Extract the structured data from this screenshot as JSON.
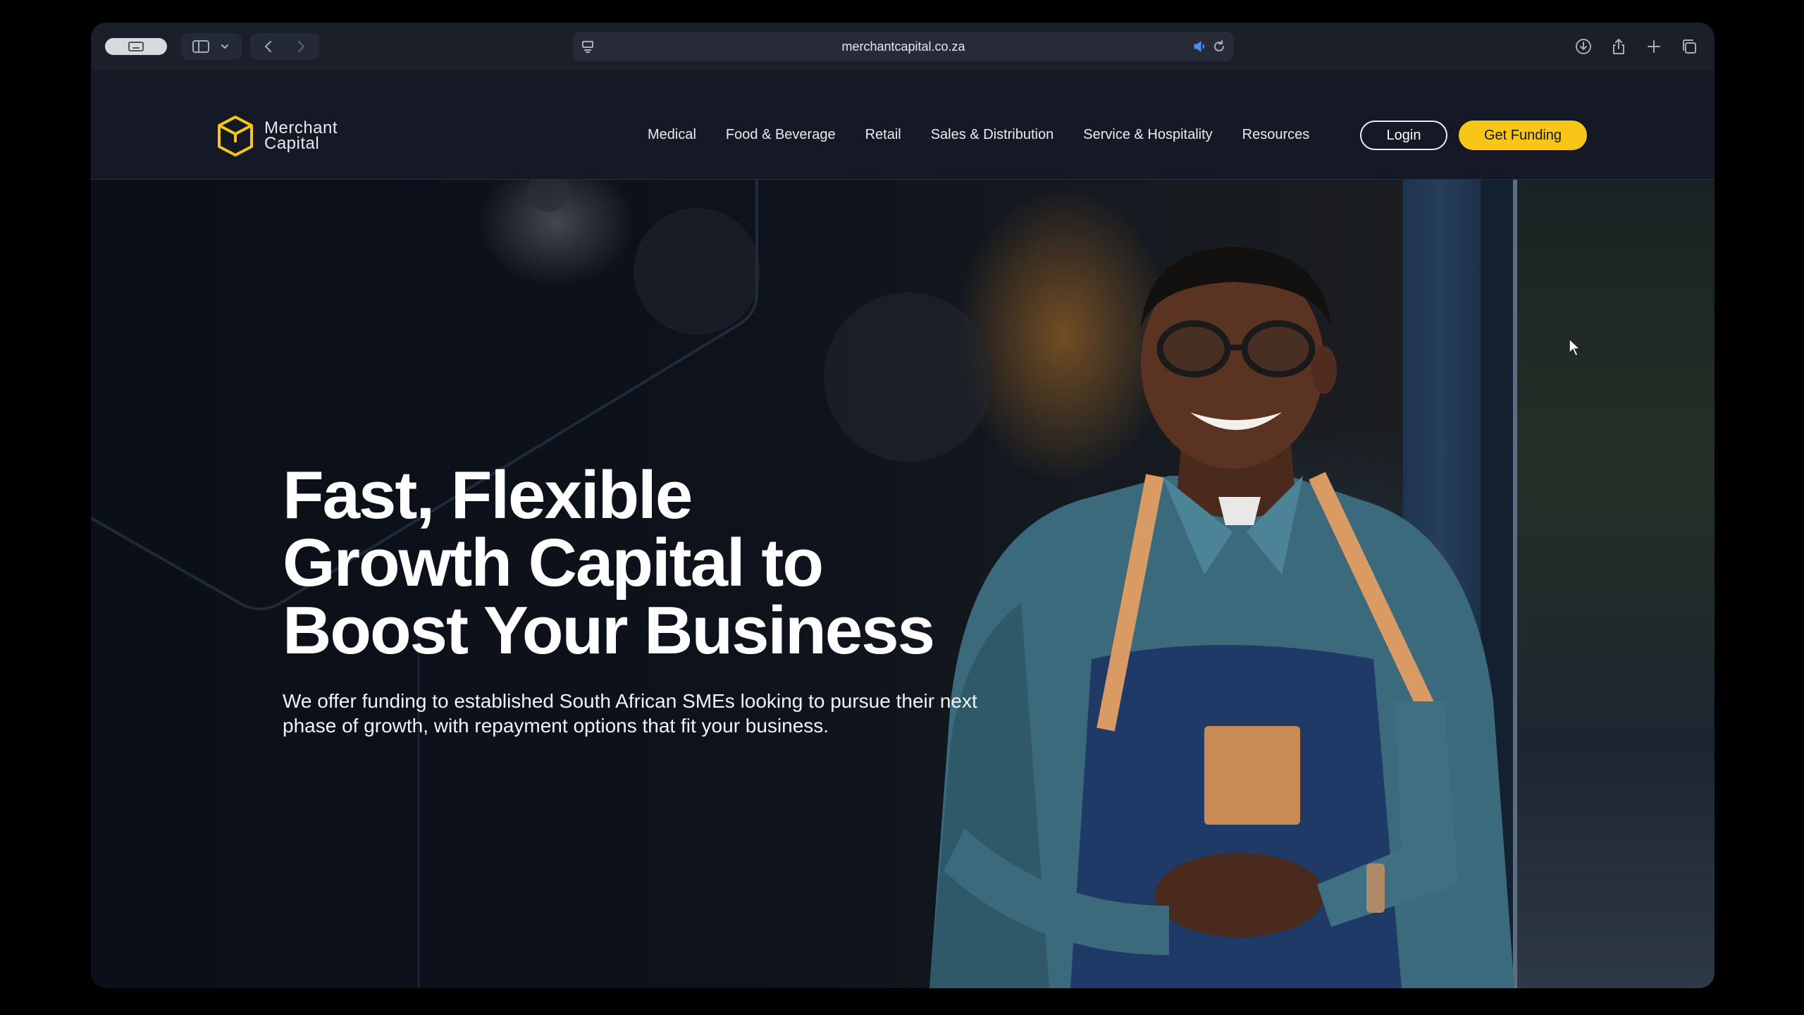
{
  "browser": {
    "url": "merchantcapital.co.za",
    "icons": {
      "tab_overview": "tab-overview-icon",
      "sidebar": "sidebar-icon",
      "chevron": "chevron-down-icon",
      "back": "back-icon",
      "forward": "forward-icon",
      "page_menu": "page-menu-icon",
      "audio": "speaker-icon",
      "reload": "reload-icon",
      "downloads": "download-icon",
      "share": "share-icon",
      "new_tab": "plus-icon",
      "tabs": "tabs-icon"
    }
  },
  "site": {
    "logo": {
      "line1": "Merchant",
      "line2": "Capital",
      "icon": "cube-logo-icon"
    },
    "nav": [
      {
        "label": "Medical"
      },
      {
        "label": "Food & Beverage"
      },
      {
        "label": "Retail"
      },
      {
        "label": "Sales & Distribution"
      },
      {
        "label": "Service & Hospitality"
      },
      {
        "label": "Resources"
      }
    ],
    "login_label": "Login",
    "cta_label": "Get Funding",
    "colors": {
      "accent": "#f7c617",
      "background": "#141925"
    }
  },
  "hero": {
    "headline": [
      "Fast, Flexible",
      "Growth Capital to",
      "Boost Your Business"
    ],
    "subcopy": "We offer funding to established South African SMEs looking to pursue their next phase of growth, with repayment options that fit your business."
  }
}
